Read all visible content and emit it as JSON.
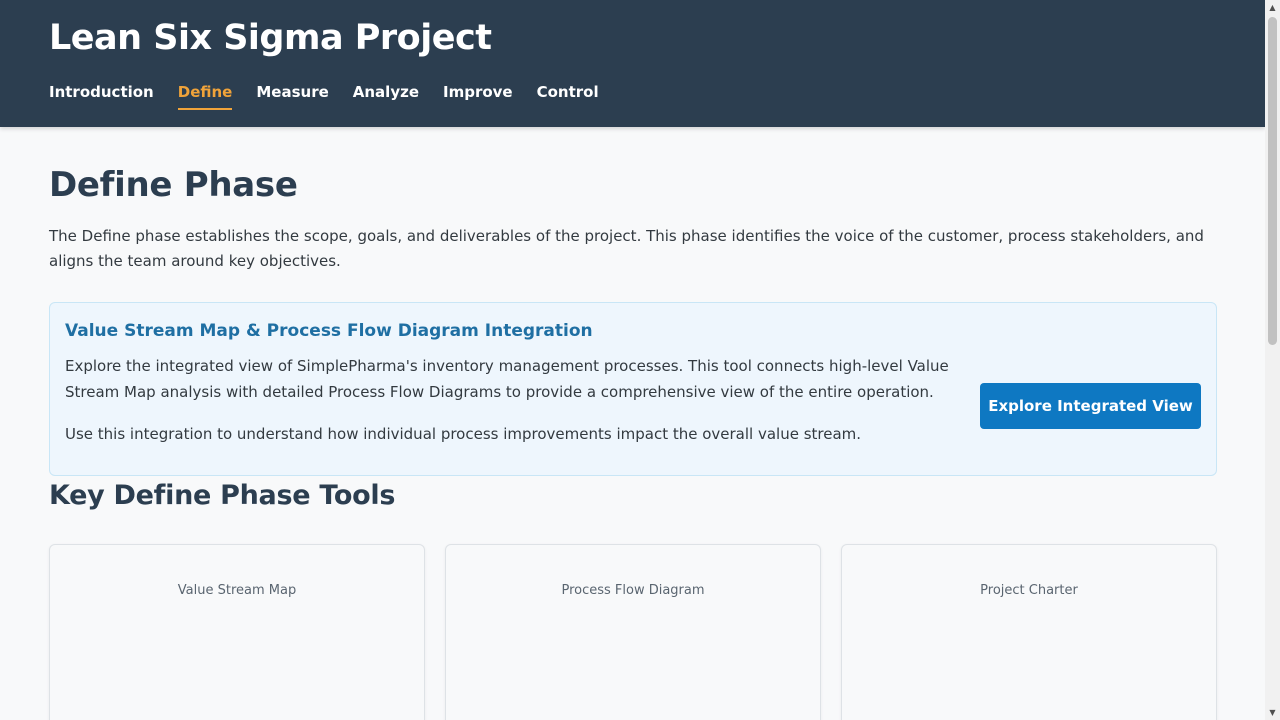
{
  "header": {
    "title": "Lean Six Sigma Project",
    "nav": [
      {
        "label": "Introduction",
        "active": false
      },
      {
        "label": "Define",
        "active": true
      },
      {
        "label": "Measure",
        "active": false
      },
      {
        "label": "Analyze",
        "active": false
      },
      {
        "label": "Improve",
        "active": false
      },
      {
        "label": "Control",
        "active": false
      }
    ]
  },
  "main": {
    "title": "Define Phase",
    "intro": "The Define phase establishes the scope, goals, and deliverables of the project. This phase identifies the voice of the customer, process stakeholders, and aligns the team around key objectives.",
    "callout": {
      "title": "Value Stream Map & Process Flow Diagram Integration",
      "text1": "Explore the integrated view of SimplePharma's inventory management processes. This tool connects high-level Value Stream Map analysis with detailed Process Flow Diagrams to provide a comprehensive view of the entire operation.",
      "text2": "Use this integration to understand how individual process improvements impact the overall value stream.",
      "button_label": "Explore Integrated View"
    },
    "tools_title": "Key Define Phase Tools",
    "tools": [
      {
        "label": "Value Stream Map"
      },
      {
        "label": "Process Flow Diagram"
      },
      {
        "label": "Project Charter"
      }
    ]
  },
  "colors": {
    "header_bg": "#2c3e50",
    "nav_active": "#f0a33a",
    "accent": "#0e78c2",
    "callout_bg": "#eef6fd",
    "callout_title": "#1f6fa3"
  },
  "icons": {
    "scroll_up": "▲",
    "scroll_down": "▼"
  }
}
